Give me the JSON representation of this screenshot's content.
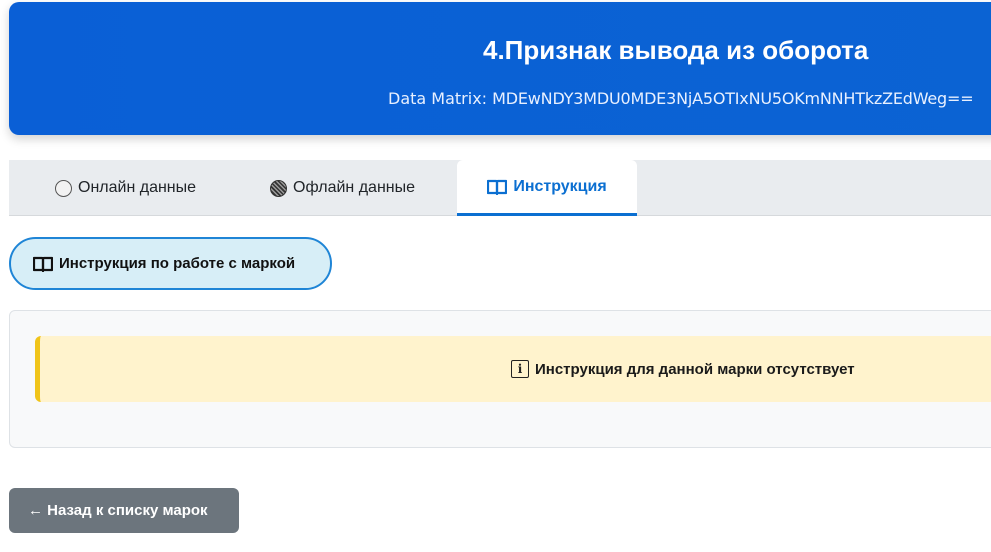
{
  "header": {
    "title": "4.Признак вывода из оборота",
    "datamatrix_label": "Data Matrix:",
    "datamatrix_value": "MDEwNDY3MDU0MDE3NjA5OTIxNU5OKmNNHTkzZEdWeg=="
  },
  "tabs": [
    {
      "label": "Онлайн данные",
      "icon": "radio-empty-icon",
      "active": false
    },
    {
      "label": "Офлайн данные",
      "icon": "radio-hatched-icon",
      "active": false
    },
    {
      "label": "Инструкция",
      "icon": "book-icon",
      "active": true
    }
  ],
  "instruction_button": {
    "label": "Инструкция по работе с маркой",
    "icon": "book-icon"
  },
  "alert": {
    "message": "Инструкция для данной марки отсутствует",
    "icon": "info-icon"
  },
  "back_button": {
    "label": "← Назад к списку марок"
  },
  "colors": {
    "header_bg": "#0b63d3",
    "tab_active": "#0b6fd1",
    "alert_bg": "#fff3cd",
    "alert_border": "#f0c419",
    "back_button_bg": "#6c757d",
    "instruction_button_bg": "#d7eef7"
  }
}
